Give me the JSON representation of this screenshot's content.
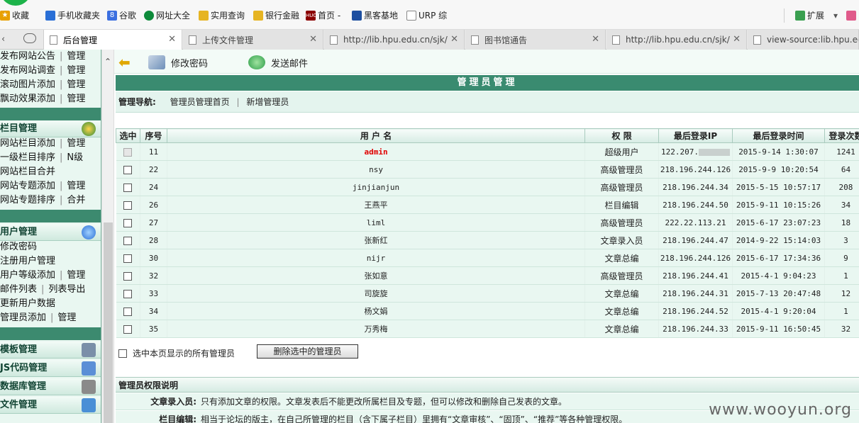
{
  "bookmarks": [
    {
      "label": "收藏",
      "icon": "star-icon",
      "color": "#e8a000"
    },
    {
      "label": "手机收藏夹",
      "icon": "phone-icon",
      "color": "#2a6fd6"
    },
    {
      "label": "谷歌",
      "icon": "google-icon",
      "color": "#3b6fe0"
    },
    {
      "label": "网址大全",
      "icon": "globe-icon",
      "color": "#0d8a3a"
    },
    {
      "label": "实用查询",
      "icon": "folder-icon",
      "color": "#e6b422"
    },
    {
      "label": "银行金融",
      "icon": "folder-icon",
      "color": "#e6b422"
    },
    {
      "label": "首页 -",
      "icon": "huc-icon",
      "color": "#8b0000"
    },
    {
      "label": "黑客基地",
      "icon": "page-icon",
      "color": "#1e4fa0"
    },
    {
      "label": "URP 综",
      "icon": "doc-icon",
      "color": "#888888"
    },
    {
      "label": "扩展",
      "icon": "grid-icon",
      "color": "#3a9f50"
    }
  ],
  "tabs": [
    {
      "label": "后台管理",
      "active": true
    },
    {
      "label": "上传文件管理",
      "active": false
    },
    {
      "label": "http://lib.hpu.edu.cn/sjk/",
      "active": false
    },
    {
      "label": "图书馆通告",
      "active": false
    },
    {
      "label": "http://lib.hpu.edu.cn/sjk/",
      "active": false
    },
    {
      "label": "view-source:lib.hpu.ec",
      "active": false
    }
  ],
  "sidebar": {
    "top_rows": [
      {
        "a": "发布网站公告",
        "b": "管理"
      },
      {
        "a": "发布网站调查",
        "b": "管理"
      },
      {
        "a": "滚动图片添加",
        "b": "管理"
      },
      {
        "a": "飘动效果添加",
        "b": "管理"
      }
    ],
    "column_head": "栏目管理",
    "column_rows": [
      {
        "a": "网站栏目添加",
        "b": "管理"
      },
      {
        "a": "一级栏目排序",
        "b": "N级"
      },
      {
        "a": "网站栏目合并",
        "b": ""
      },
      {
        "a": "网站专题添加",
        "b": "管理"
      },
      {
        "a": "网站专题排序",
        "b": "合并"
      }
    ],
    "user_head": "用户管理",
    "user_rows": [
      {
        "a": "修改密码",
        "b": ""
      },
      {
        "a": "注册用户管理",
        "b": ""
      },
      {
        "a": "用户等级添加",
        "b": "管理"
      },
      {
        "a": "邮件列表",
        "b": "列表导出"
      },
      {
        "a": "更新用户数据",
        "b": ""
      },
      {
        "a": "管理员添加",
        "b": "管理"
      }
    ],
    "bottom_heads": [
      "模板管理",
      "JS代码管理",
      "数据库管理",
      "文件管理"
    ]
  },
  "toolbar": {
    "change_password": "修改密码",
    "send_mail": "发送邮件"
  },
  "panel": {
    "title": "管理员管理",
    "nav_label": "管理导航:",
    "nav_home": "管理员管理首页",
    "nav_add": "新增管理员"
  },
  "table": {
    "headers": [
      "选中",
      "序号",
      "用 户 名",
      "权 限",
      "最后登录IP",
      "最后登录时间",
      "登录次数"
    ],
    "rows": [
      {
        "id": "11",
        "user": "admin",
        "role": "超级用户",
        "ip": "122.207.",
        "time": "2015-9-14 1:30:07",
        "count": "1241"
      },
      {
        "id": "22",
        "user": "nsy",
        "role": "高级管理员",
        "ip": "218.196.244.126",
        "time": "2015-9-9 10:20:54",
        "count": "64"
      },
      {
        "id": "24",
        "user": "jinjianjun",
        "role": "高级管理员",
        "ip": "218.196.244.34",
        "time": "2015-5-15 10:57:17",
        "count": "208"
      },
      {
        "id": "26",
        "user": "王燕平",
        "role": "栏目编辑",
        "ip": "218.196.244.50",
        "time": "2015-9-11 10:15:26",
        "count": "34"
      },
      {
        "id": "27",
        "user": "liml",
        "role": "高级管理员",
        "ip": "222.22.113.21",
        "time": "2015-6-17 23:07:23",
        "count": "18"
      },
      {
        "id": "28",
        "user": "张新红",
        "role": "文章录入员",
        "ip": "218.196.244.47",
        "time": "2014-9-22 15:14:03",
        "count": "3"
      },
      {
        "id": "30",
        "user": "nijr",
        "role": "文章总编",
        "ip": "218.196.244.126",
        "time": "2015-6-17 17:34:36",
        "count": "9"
      },
      {
        "id": "32",
        "user": "张如意",
        "role": "高级管理员",
        "ip": "218.196.244.41",
        "time": "2015-4-1 9:04:23",
        "count": "1"
      },
      {
        "id": "33",
        "user": "司旋旋",
        "role": "文章总编",
        "ip": "218.196.244.31",
        "time": "2015-7-13 20:47:48",
        "count": "12"
      },
      {
        "id": "34",
        "user": "杨文娟",
        "role": "文章总编",
        "ip": "218.196.244.52",
        "time": "2015-4-1 9:20:04",
        "count": "1"
      },
      {
        "id": "35",
        "user": "万秀梅",
        "role": "文章总编",
        "ip": "218.196.244.33",
        "time": "2015-9-11 16:50:45",
        "count": "32"
      }
    ]
  },
  "actions": {
    "select_all": "选中本页显示的所有管理员",
    "delete_selected": "删除选中的管理员"
  },
  "permissions": {
    "title": "管理员权限说明",
    "rows": [
      {
        "key": "文章录入员:",
        "text": "只有添加文章的权限。文章发表后不能更改所属栏目及专题，但可以修改和删除自己发表的文章。"
      },
      {
        "key": "栏目编辑:",
        "text": "相当于论坛的版主，在自己所管理的栏目（含下属子栏目）里拥有“文章审核”、“固顶”、“推荐”等各种管理权限。"
      }
    ]
  },
  "watermark": "www.wooyun.org"
}
